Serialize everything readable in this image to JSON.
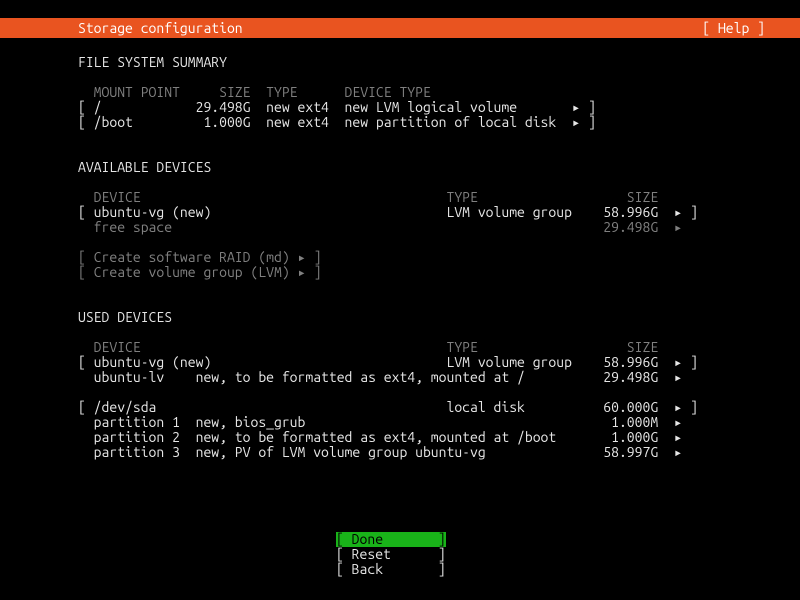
{
  "header": {
    "title": "Storage configuration",
    "help": "[ Help ]"
  },
  "sections": {
    "fss_title": "FILE SYSTEM SUMMARY",
    "fss_header": "  MOUNT POINT     SIZE  TYPE      DEVICE TYPE",
    "fss_r1": "[ /            29.498G  new ext4  new LVM logical volume       ▸ ]",
    "fss_r2": "[ /boot         1.000G  new ext4  new partition of local disk  ▸ ]",
    "avail_title": "AVAILABLE DEVICES",
    "avail_header": "  DEVICE                                       TYPE                   SIZE",
    "avail_r1": "[ ubuntu-vg (new)                              LVM volume group    58.996G  ▸ ]",
    "avail_r2": "  free space                                                       29.498G  ▸  ",
    "avail_raid": "[ Create software RAID (md) ▸ ]",
    "avail_lvm": "[ Create volume group (LVM) ▸ ]",
    "used_title": "USED DEVICES",
    "used_header": "  DEVICE                                       TYPE                   SIZE",
    "used_r1": "[ ubuntu-vg (new)                              LVM volume group    58.996G  ▸ ]",
    "used_r2": "  ubuntu-lv    new, to be formatted as ext4, mounted at /          29.498G  ▸  ",
    "used_r3": "[ /dev/sda                                     local disk          60.000G  ▸ ]",
    "used_r4": "  partition 1  new, bios_grub                                       1.000M  ▸  ",
    "used_r5": "  partition 2  new, to be formatted as ext4, mounted at /boot       1.000G  ▸  ",
    "used_r6": "  partition 3  new, PV of LVM volume group ubuntu-vg               58.997G  ▸  "
  },
  "buttons": {
    "done": "[ Done       ]",
    "reset": "[ Reset      ]",
    "back": "[ Back       ]"
  }
}
